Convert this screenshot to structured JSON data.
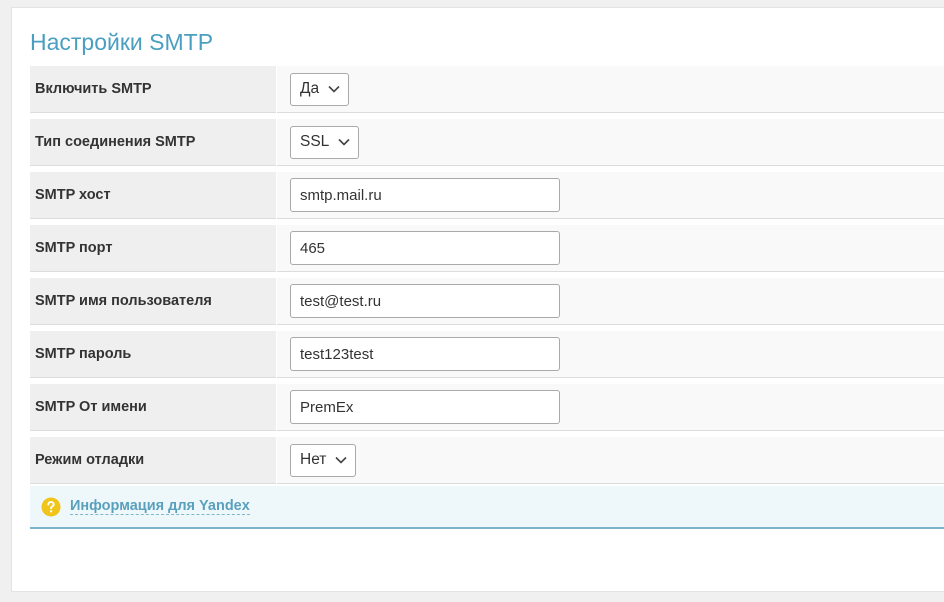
{
  "header": {
    "title": "Настройки SMTP"
  },
  "fields": [
    {
      "label": "Включить SMTP",
      "type": "select",
      "value": "Да"
    },
    {
      "label": "Тип соединения SMTP",
      "type": "select",
      "value": "SSL"
    },
    {
      "label": "SMTP хост",
      "type": "input",
      "value": "smtp.mail.ru"
    },
    {
      "label": "SMTP порт",
      "type": "input",
      "value": "465"
    },
    {
      "label": "SMTP имя пользователя",
      "type": "input",
      "value": "test@test.ru"
    },
    {
      "label": "SMTP пароль",
      "type": "input",
      "value": "test123test"
    },
    {
      "label": "SMTP От имени",
      "type": "input",
      "value": "PremEx"
    },
    {
      "label": "Режим отладки",
      "type": "select",
      "value": "Нет"
    }
  ],
  "info": {
    "link_label": "Информация для Yandex",
    "icon": "question-circle-icon",
    "icon_color": "#f0c419"
  },
  "colors": {
    "title": "#4a9fc0",
    "link": "#5aa0bd",
    "info_bg": "#eef8fb"
  }
}
